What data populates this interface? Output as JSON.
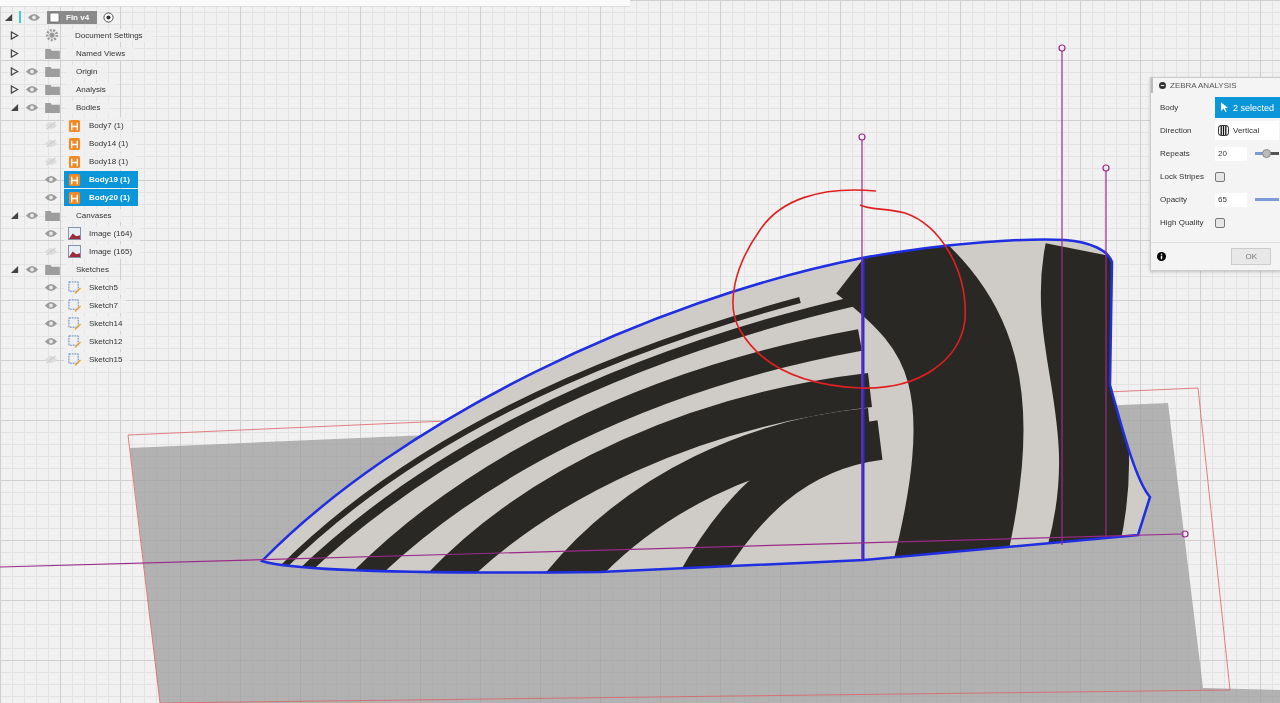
{
  "browser": {
    "label": "Fin v4",
    "expanded": true,
    "visible": true,
    "children": [
      {
        "kind": "settings",
        "label": "Document Settings",
        "expanded": false
      },
      {
        "kind": "folder",
        "label": "Named Views",
        "expanded": false
      },
      {
        "kind": "folder",
        "label": "Origin",
        "expanded": false,
        "visible": true
      },
      {
        "kind": "folder",
        "label": "Analysis",
        "expanded": false,
        "visible": true
      },
      {
        "kind": "folder",
        "label": "Bodies",
        "expanded": true,
        "visible": true,
        "children": [
          {
            "kind": "body",
            "label": "Body7 (1)",
            "visible": false,
            "selected": false
          },
          {
            "kind": "body",
            "label": "Body14 (1)",
            "visible": false,
            "selected": false
          },
          {
            "kind": "body",
            "label": "Body18 (1)",
            "visible": false,
            "selected": false
          },
          {
            "kind": "body",
            "label": "Body19 (1)",
            "visible": true,
            "selected": true
          },
          {
            "kind": "body",
            "label": "Body20 (1)",
            "visible": true,
            "selected": true
          }
        ]
      },
      {
        "kind": "folder",
        "label": "Canvases",
        "expanded": true,
        "visible": true,
        "children": [
          {
            "kind": "canvas",
            "label": "Image (164)",
            "visible": true,
            "selected": false
          },
          {
            "kind": "canvas",
            "label": "Image (165)",
            "visible": false,
            "selected": false
          }
        ]
      },
      {
        "kind": "folder",
        "label": "Sketches",
        "expanded": true,
        "visible": true,
        "children": [
          {
            "kind": "sketch",
            "label": "Sketch5",
            "visible": true,
            "selected": false
          },
          {
            "kind": "sketch",
            "label": "Sketch7",
            "visible": true,
            "selected": false
          },
          {
            "kind": "sketch",
            "label": "Sketch14",
            "visible": true,
            "selected": false
          },
          {
            "kind": "sketch",
            "label": "Sketch12",
            "visible": true,
            "selected": false
          },
          {
            "kind": "sketch",
            "label": "Sketch15",
            "visible": false,
            "selected": false
          }
        ]
      }
    ]
  },
  "zebra_panel": {
    "title": "ZEBRA ANALYSIS",
    "rows": [
      {
        "kind": "selection",
        "label": "Body",
        "value": "2 selected"
      },
      {
        "kind": "dropdown",
        "label": "Direction",
        "value": "Vertical"
      },
      {
        "kind": "slider",
        "label": "Repeats",
        "value": "20",
        "level": 0.45
      },
      {
        "kind": "checkbox",
        "label": "Lock Stripes",
        "checked": false
      },
      {
        "kind": "slider",
        "label": "Opacity",
        "value": "65"
      },
      {
        "kind": "checkbox",
        "label": "High Quality",
        "checked": false
      }
    ],
    "ok_button": "OK"
  }
}
